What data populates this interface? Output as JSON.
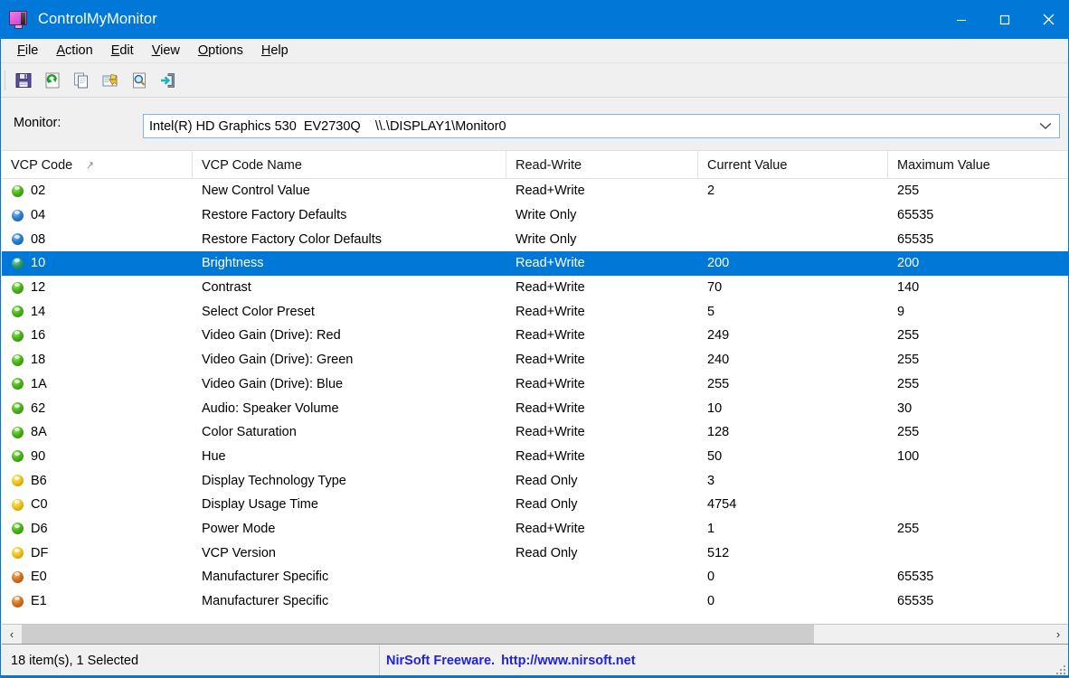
{
  "window": {
    "title": "ControlMyMonitor",
    "icon": "monitor-icon",
    "accent_color": "#0078d7",
    "minimize_label": "Minimize",
    "maximize_label": "Maximize",
    "close_label": "Close"
  },
  "menubar": {
    "items": [
      {
        "label": "File",
        "accel": "F"
      },
      {
        "label": "Action",
        "accel": "A"
      },
      {
        "label": "Edit",
        "accel": "E"
      },
      {
        "label": "View",
        "accel": "V"
      },
      {
        "label": "Options",
        "accel": "O"
      },
      {
        "label": "Help",
        "accel": "H"
      }
    ]
  },
  "toolbar": {
    "buttons": [
      {
        "icon": "save-icon",
        "tooltip": "Save"
      },
      {
        "icon": "refresh-icon",
        "tooltip": "Refresh"
      },
      {
        "icon": "copy-icon",
        "tooltip": "Copy"
      },
      {
        "icon": "properties-icon",
        "tooltip": "Properties"
      },
      {
        "icon": "find-icon",
        "tooltip": "Find"
      },
      {
        "icon": "exit-icon",
        "tooltip": "Exit"
      }
    ]
  },
  "monitor_selector": {
    "label": "Monitor:",
    "value": "Intel(R) HD Graphics 530  EV2730Q    \\\\.\\DISPLAY1\\Monitor0",
    "arrow_icon": "chevron-down-icon"
  },
  "list": {
    "sort_column": "VCP Code",
    "sort_indicator": "↗",
    "columns": [
      "VCP Code",
      "VCP Code Name",
      "Read-Write",
      "Current Value",
      "Maximum Value"
    ],
    "rows": [
      {
        "bullet": "green",
        "code": "02",
        "name": "New Control Value",
        "rw": "Read+Write",
        "current": "2",
        "maximum": "255",
        "selected": false
      },
      {
        "bullet": "blue",
        "code": "04",
        "name": "Restore Factory Defaults",
        "rw": "Write Only",
        "current": "",
        "maximum": "65535",
        "selected": false
      },
      {
        "bullet": "blue",
        "code": "08",
        "name": "Restore Factory Color Defaults",
        "rw": "Write Only",
        "current": "",
        "maximum": "65535",
        "selected": false
      },
      {
        "bullet": "teal",
        "code": "10",
        "name": "Brightness",
        "rw": "Read+Write",
        "current": "200",
        "maximum": "200",
        "selected": true
      },
      {
        "bullet": "green",
        "code": "12",
        "name": "Contrast",
        "rw": "Read+Write",
        "current": "70",
        "maximum": "140",
        "selected": false
      },
      {
        "bullet": "green",
        "code": "14",
        "name": "Select Color Preset",
        "rw": "Read+Write",
        "current": "5",
        "maximum": "9",
        "selected": false
      },
      {
        "bullet": "green",
        "code": "16",
        "name": "Video Gain (Drive): Red",
        "rw": "Read+Write",
        "current": "249",
        "maximum": "255",
        "selected": false
      },
      {
        "bullet": "green",
        "code": "18",
        "name": "Video Gain (Drive): Green",
        "rw": "Read+Write",
        "current": "240",
        "maximum": "255",
        "selected": false
      },
      {
        "bullet": "green",
        "code": "1A",
        "name": "Video Gain (Drive): Blue",
        "rw": "Read+Write",
        "current": "255",
        "maximum": "255",
        "selected": false
      },
      {
        "bullet": "green",
        "code": "62",
        "name": "Audio: Speaker Volume",
        "rw": "Read+Write",
        "current": "10",
        "maximum": "30",
        "selected": false
      },
      {
        "bullet": "green",
        "code": "8A",
        "name": "Color Saturation",
        "rw": "Read+Write",
        "current": "128",
        "maximum": "255",
        "selected": false
      },
      {
        "bullet": "green",
        "code": "90",
        "name": "Hue",
        "rw": "Read+Write",
        "current": "50",
        "maximum": "100",
        "selected": false
      },
      {
        "bullet": "yellow",
        "code": "B6",
        "name": "Display Technology Type",
        "rw": "Read Only",
        "current": "3",
        "maximum": "",
        "selected": false
      },
      {
        "bullet": "yellow",
        "code": "C0",
        "name": "Display Usage Time",
        "rw": "Read Only",
        "current": "4754",
        "maximum": "",
        "selected": false
      },
      {
        "bullet": "green",
        "code": "D6",
        "name": "Power Mode",
        "rw": "Read+Write",
        "current": "1",
        "maximum": "255",
        "selected": false
      },
      {
        "bullet": "yellow",
        "code": "DF",
        "name": "VCP Version",
        "rw": "Read Only",
        "current": "512",
        "maximum": "",
        "selected": false
      },
      {
        "bullet": "orange",
        "code": "E0",
        "name": "Manufacturer Specific",
        "rw": "",
        "current": "0",
        "maximum": "65535",
        "selected": false
      },
      {
        "bullet": "orange",
        "code": "E1",
        "name": "Manufacturer Specific",
        "rw": "",
        "current": "0",
        "maximum": "65535",
        "selected": false
      }
    ]
  },
  "scrollbar": {
    "left_arrow": "‹",
    "right_arrow": "›"
  },
  "statusbar": {
    "item_count_text": "18 item(s), 1 Selected",
    "credit_text": "NirSoft Freeware.",
    "credit_url_text": "http://www.nirsoft.net",
    "link_color": "#2020e0"
  }
}
